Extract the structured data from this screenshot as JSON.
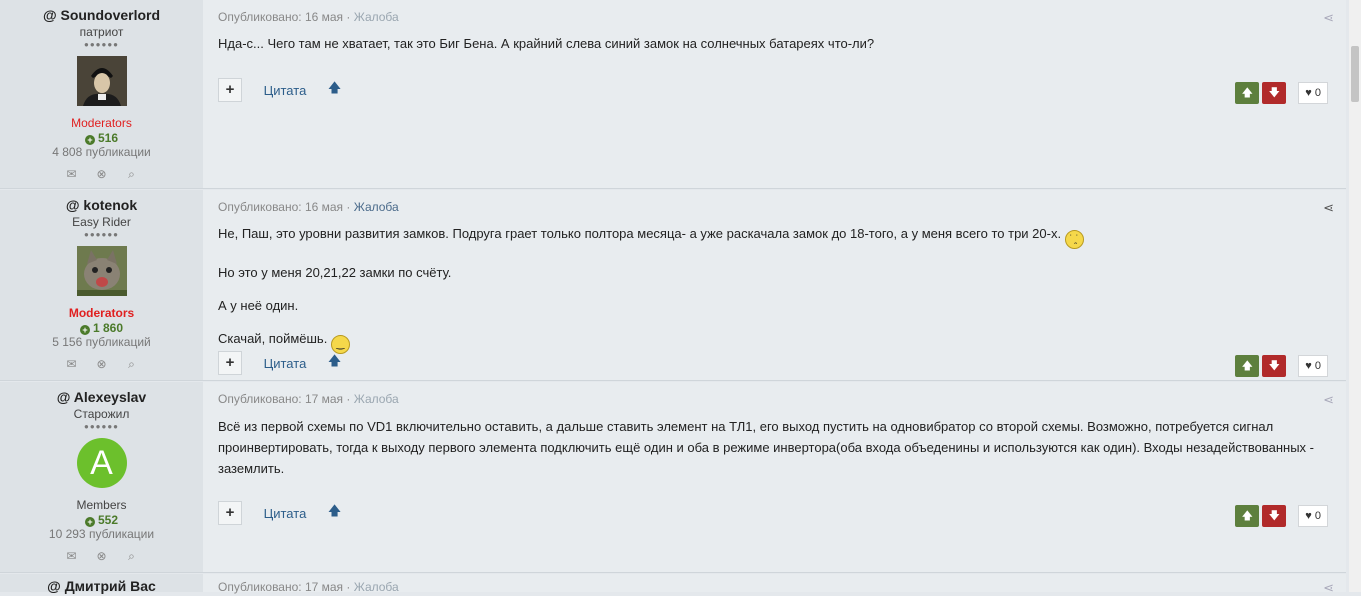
{
  "posts": [
    {
      "author": "@ Soundoverlord",
      "rank": "патриот",
      "pips": "●●●●●●",
      "group": "Moderators",
      "reputation": "516",
      "publications": "4 808 публикации",
      "meta_published": "Опубликовано: 16 мая",
      "report": "Жалоба",
      "paragraphs": [
        "Нда-с... Чего там не хватает, так это Биг Бена. А крайний слева синий замок на солнечных батареях что-ли?"
      ],
      "likes": "0"
    },
    {
      "author": "@ kotenok",
      "rank": "Easy Rider",
      "pips": "●●●●●●",
      "group": "Moderators",
      "reputation": "1 860",
      "publications": "5 156 публикаций",
      "meta_published": "Опубликовано: 16 мая",
      "report": "Жалоба",
      "paragraphs": [
        "Не, Паш, это уровни развития замков. Подруга  грает только полтора месяца- а уже раскачала замок до 18-того, а у меня всего то три 20-х.",
        "Но это у меня 20,21,22 замки по счёту.",
        "А у неё один.",
        "Скачай, поймёшь."
      ],
      "likes": "0"
    },
    {
      "author": "@ Alexeyslav",
      "rank": "Старожил",
      "pips": "●●●●●●",
      "avatar_letter": "A",
      "group": "Members",
      "reputation": "552",
      "publications": "10 293 публикации",
      "meta_published": "Опубликовано: 17 мая",
      "report": "Жалоба",
      "paragraphs": [
        "Всё из первой схемы по VD1 включительно оставить, а дальше ставить элемент на ТЛ1, его выход пустить на одновибратор со второй схемы. Возможно, потребуется сигнал проинвертировать, тогда к выходу первого элемента подключить ещё один и оба в режиме инвертора(оба входа объеденины и используются как один). Входы незадействованных - заземлить."
      ],
      "likes": "0"
    },
    {
      "author": "@ Дмитрий Вас",
      "meta_published": "Опубликовано: 17 мая",
      "report": "Жалоба"
    }
  ],
  "labels": {
    "quote": "Цитата",
    "plus": "+"
  },
  "colors": {
    "moderators": "#e02020",
    "reputation": "#4b7a2a",
    "vote_up": "#5d7f3d",
    "vote_down": "#b12a2a",
    "link": "#2c5d8a"
  }
}
